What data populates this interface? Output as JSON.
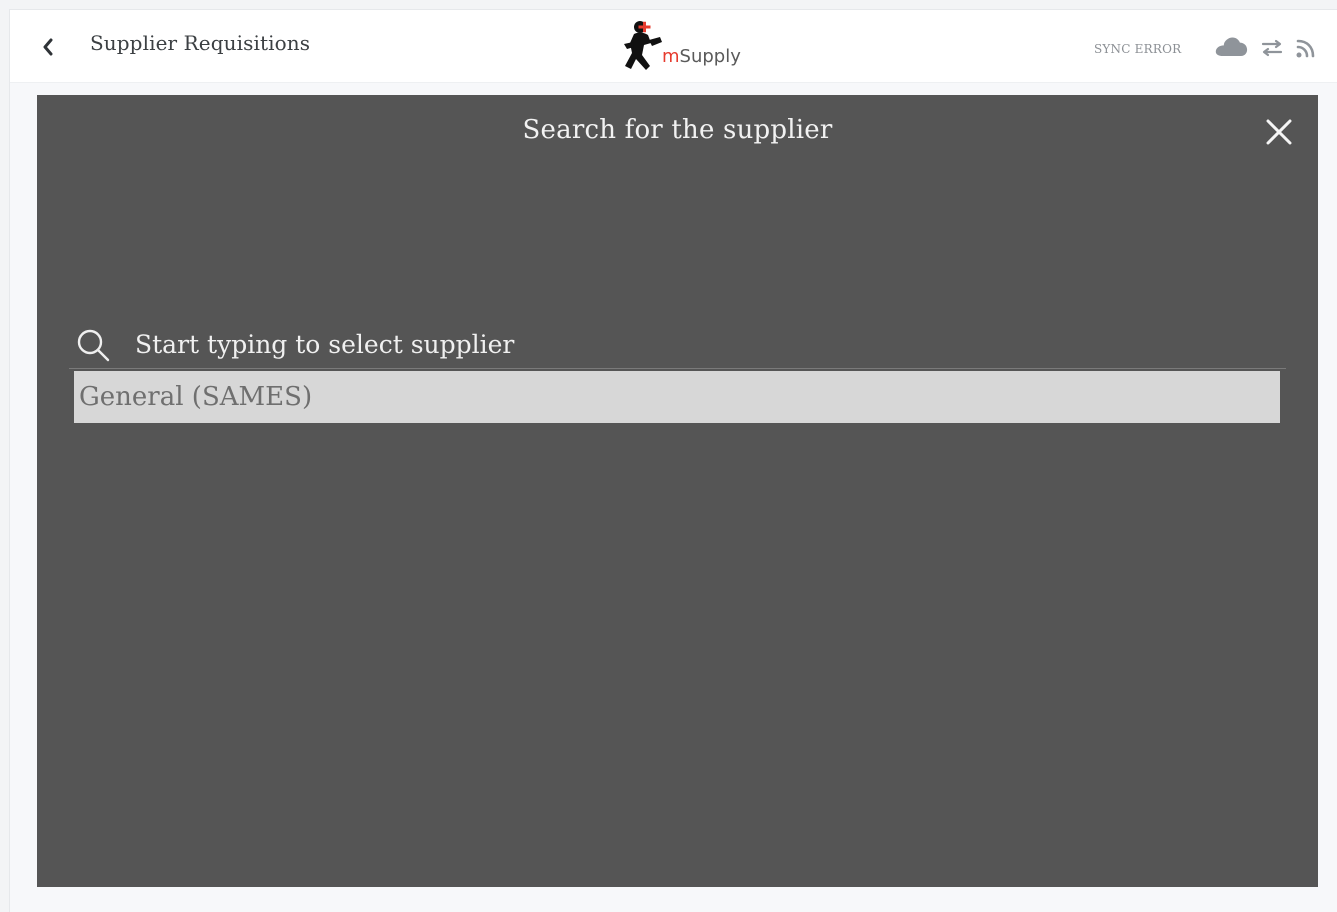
{
  "header": {
    "back_icon": "chevron-left-icon",
    "title": "Supplier Requisitions",
    "logo": {
      "m_text": "m",
      "brand_text": "Supply",
      "accent_color": "#e63b2e"
    },
    "sync_status": "SYNC ERROR",
    "status_icons": [
      "cloud-icon",
      "sync-arrows-icon",
      "rss-icon"
    ]
  },
  "modal": {
    "title": "Search for the supplier",
    "close_icon": "close-icon",
    "search": {
      "icon": "search-icon",
      "value": "",
      "placeholder": "Start typing to select supplier"
    },
    "suppliers": [
      {
        "label": "General (SAMES)"
      }
    ]
  }
}
